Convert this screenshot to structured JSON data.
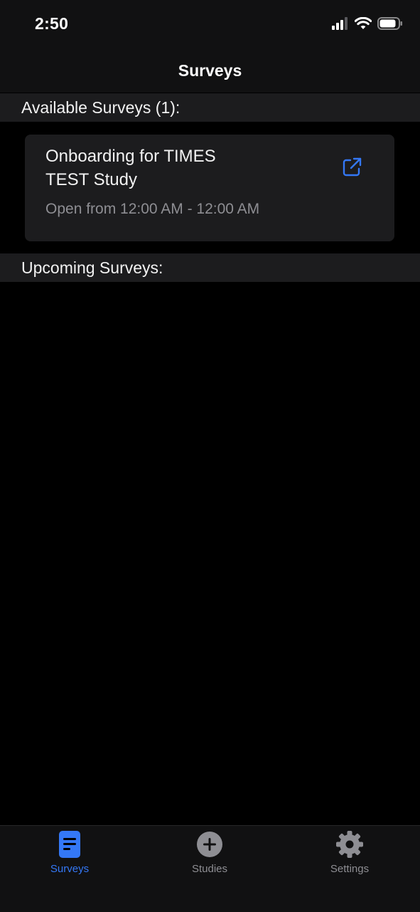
{
  "status_bar": {
    "time": "2:50",
    "icons": [
      "cellular-signal-icon",
      "wifi-icon",
      "battery-icon"
    ]
  },
  "nav": {
    "title": "Surveys"
  },
  "sections": {
    "available": "Available Surveys (1):",
    "upcoming": "Upcoming Surveys:"
  },
  "surveys": [
    {
      "title": "Onboarding for TIMES TEST Study",
      "subtitle": "Open from 12:00 AM - 12:00 AM",
      "icon": "open-external-icon"
    }
  ],
  "tab_bar": {
    "items": [
      {
        "label": "Surveys",
        "icon": "document-icon",
        "active": true
      },
      {
        "label": "Studies",
        "icon": "plus-circle-icon",
        "active": false
      },
      {
        "label": "Settings",
        "icon": "gear-icon",
        "active": false
      }
    ]
  },
  "colors": {
    "accent": "#3478f6",
    "inactive": "#8e8e93",
    "background": "#000000",
    "card": "#1c1c1e"
  }
}
